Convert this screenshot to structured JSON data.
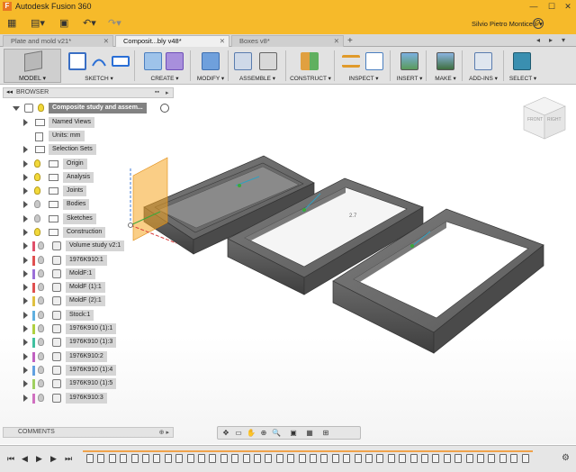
{
  "window": {
    "app_logo": "F",
    "title": "Autodesk Fusion 360",
    "controls": [
      "—",
      "☐",
      "✕"
    ]
  },
  "quick_access": {
    "user_name": "Silvio Pietro Monticelli",
    "user_chevron": "▾",
    "help": "?"
  },
  "doc_tabs": [
    {
      "label": "Plate and    mold v21*",
      "active": false
    },
    {
      "label": "Composit...bly v48*",
      "active": true
    },
    {
      "label": "Boxes v8*",
      "active": false
    }
  ],
  "toolbar": {
    "workspace_label": "MODEL ▾",
    "groups": [
      {
        "label": "SKETCH ▾"
      },
      {
        "label": "CREATE ▾"
      },
      {
        "label": "MODIFY ▾"
      },
      {
        "label": "ASSEMBLE ▾"
      },
      {
        "label": "CONSTRUCT ▾"
      },
      {
        "label": "INSPECT ▾"
      },
      {
        "label": "INSERT ▾"
      },
      {
        "label": "MAKE ▾"
      },
      {
        "label": "ADD-INS ▾"
      },
      {
        "label": "SELECT ▾"
      }
    ]
  },
  "browser": {
    "title": "BROWSER",
    "items": [
      {
        "label": "Composite study and assem...",
        "kind": "root"
      },
      {
        "label": "Named Views",
        "kind": "folder"
      },
      {
        "label": "Units: mm",
        "kind": "doc"
      },
      {
        "label": "Selection Sets",
        "kind": "folder"
      },
      {
        "label": "Origin",
        "kind": "folder",
        "bulb": true
      },
      {
        "label": "Analysis",
        "kind": "folder",
        "bulb": true
      },
      {
        "label": "Joints",
        "kind": "folder",
        "bulb": true
      },
      {
        "label": "Bodies",
        "kind": "folder",
        "bulb": false
      },
      {
        "label": "Sketches",
        "kind": "folder",
        "bulb": false
      },
      {
        "label": "Construction",
        "kind": "folder",
        "bulb": true
      },
      {
        "label": "Volume study v2:1",
        "kind": "comp",
        "chip": "#e0506a"
      },
      {
        "label": "1976K910:1",
        "kind": "comp",
        "chip": "#e05050"
      },
      {
        "label": "MoldF:1",
        "kind": "comp",
        "chip": "#9b6fd8"
      },
      {
        "label": "MoldF (1):1",
        "kind": "comp",
        "chip": "#e05050"
      },
      {
        "label": "MoldF (2):1",
        "kind": "comp",
        "chip": "#e0c040"
      },
      {
        "label": "Stock:1",
        "kind": "comp",
        "chip": "#60b0e0"
      },
      {
        "label": "1976K910 (1):1",
        "kind": "comp",
        "chip": "#b0d040"
      },
      {
        "label": "1976K910 (1):3",
        "kind": "comp",
        "chip": "#40c0a0"
      },
      {
        "label": "1976K910:2",
        "kind": "comp",
        "chip": "#c060c0"
      },
      {
        "label": "1976K910 (1):4",
        "kind": "comp",
        "chip": "#60a0e0"
      },
      {
        "label": "1976K910 (1):5",
        "kind": "comp",
        "chip": "#a0d060"
      },
      {
        "label": "1976K910:3",
        "kind": "comp",
        "chip": "#d070c0"
      }
    ]
  },
  "viewcube": {
    "front": "FRONT",
    "right": "RIGHT"
  },
  "viewport_marks": {
    "part_label": "2.7"
  },
  "comments": {
    "label": "COMMENTS"
  },
  "colors": {
    "title_bar": "#f6ba2a",
    "sketch_plane": "#f6a623",
    "part_body": "#6e6e6e",
    "timeline_marker": "#f0a24a"
  }
}
